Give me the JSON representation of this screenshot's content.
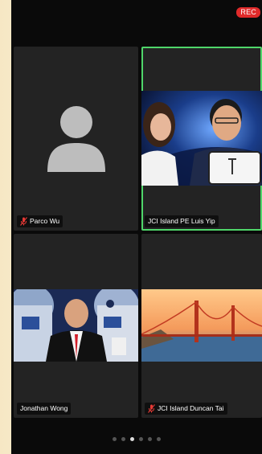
{
  "recording": {
    "label": "REC"
  },
  "participants": [
    {
      "name": "Parco Wu",
      "muted": true
    },
    {
      "name": "JCI Island PE Luis Yip",
      "muted": false,
      "active_speaker": true
    },
    {
      "name": "Jonathan Wong",
      "muted": false
    },
    {
      "name": "JCI Island Duncan Tai",
      "muted": true
    }
  ],
  "pagination": {
    "total": 6,
    "current": 3
  },
  "colors": {
    "active_speaker_border": "#4fd66a",
    "rec_badge": "#e02a2a",
    "muted_icon": "#e53935"
  }
}
